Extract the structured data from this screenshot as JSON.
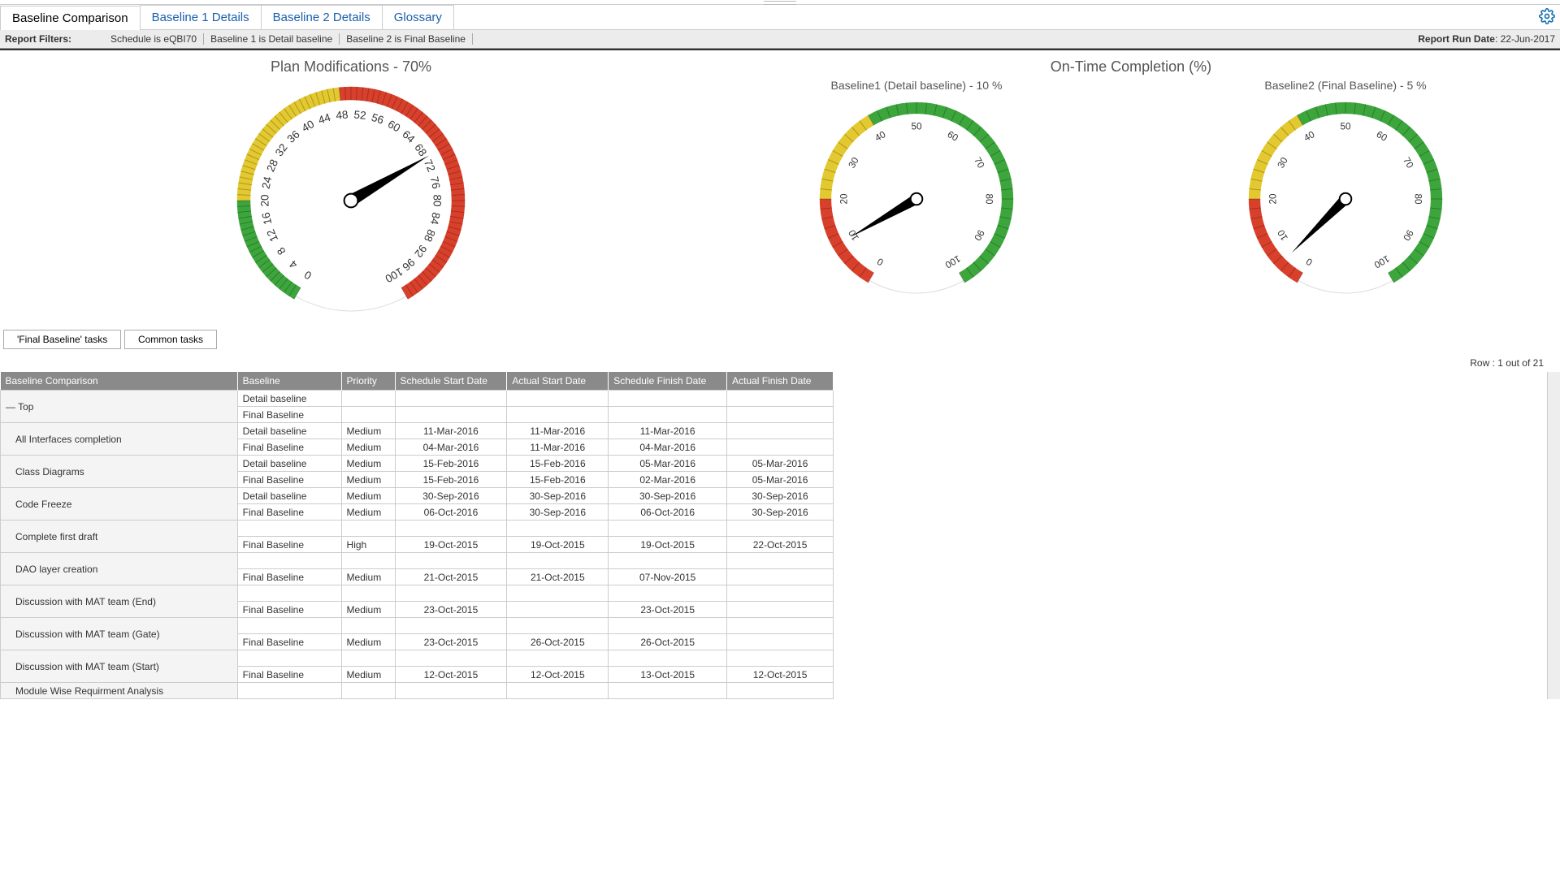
{
  "tabs": {
    "t0": "Baseline Comparison",
    "t1": "Baseline 1 Details",
    "t2": "Baseline 2 Details",
    "t3": "Glossary"
  },
  "filters": {
    "label": "Report Filters:",
    "f0": "Schedule   is   eQBI70",
    "f1": "Baseline 1   is   Detail baseline",
    "f2": "Baseline 2   is   Final Baseline",
    "run_label": "Report Run Date",
    "run_value": ": 22-Jun-2017"
  },
  "gauges": {
    "plan_title": "Plan Modifications - 70%",
    "ontime_title": "On-Time Completion (%)",
    "b1_sub": "Baseline1 (Detail baseline) - 10 %",
    "b2_sub": "Baseline2 (Final Baseline) - 5 %"
  },
  "buttons": {
    "final": "'Final Baseline' tasks",
    "common": "Common tasks"
  },
  "row_info": "Row : 1 out of 21",
  "columns": {
    "c0": "Baseline Comparison",
    "c1": "Baseline",
    "c2": "Priority",
    "c3": "Schedule Start Date",
    "c4": "Actual Start Date",
    "c5": "Schedule Finish Date",
    "c6": "Actual Finish Date"
  },
  "rows": {
    "top": "Top",
    "r0": {
      "name": "All Interfaces completion",
      "b0": "Detail baseline",
      "b1": "Final Baseline",
      "p": "Medium",
      "d00": "11-Mar-2016",
      "d01": "11-Mar-2016",
      "d02": "11-Mar-2016",
      "d03": "",
      "d10": "04-Mar-2016",
      "d11": "11-Mar-2016",
      "d12": "04-Mar-2016",
      "d13": ""
    },
    "r1": {
      "name": "Class Diagrams",
      "b0": "Detail baseline",
      "b1": "Final Baseline",
      "p": "Medium",
      "d00": "15-Feb-2016",
      "d01": "15-Feb-2016",
      "d02": "05-Mar-2016",
      "d03": "05-Mar-2016",
      "d10": "15-Feb-2016",
      "d11": "15-Feb-2016",
      "d12": "02-Mar-2016",
      "d13": "05-Mar-2016"
    },
    "r2": {
      "name": "Code Freeze",
      "b0": "Detail baseline",
      "b1": "Final Baseline",
      "p": "Medium",
      "d00": "30-Sep-2016",
      "d01": "30-Sep-2016",
      "d02": "30-Sep-2016",
      "d03": "30-Sep-2016",
      "d10": "06-Oct-2016",
      "d11": "30-Sep-2016",
      "d12": "06-Oct-2016",
      "d13": "30-Sep-2016"
    },
    "r3": {
      "name": "Complete first draft",
      "b0": "",
      "b1": "Final Baseline",
      "p0": "",
      "p1": "High",
      "d00": "",
      "d01": "",
      "d02": "",
      "d03": "",
      "d10": "19-Oct-2015",
      "d11": "19-Oct-2015",
      "d12": "19-Oct-2015",
      "d13": "22-Oct-2015"
    },
    "r4": {
      "name": "DAO layer creation",
      "b0": "",
      "b1": "Final Baseline",
      "p0": "",
      "p1": "Medium",
      "d00": "",
      "d01": "",
      "d02": "",
      "d03": "",
      "d10": "21-Oct-2015",
      "d11": "21-Oct-2015",
      "d12": "07-Nov-2015",
      "d13": ""
    },
    "r5": {
      "name": "Discussion with MAT team (End)",
      "b0": "",
      "b1": "Final Baseline",
      "p0": "",
      "p1": "Medium",
      "d00": "",
      "d01": "",
      "d02": "",
      "d03": "",
      "d10": "23-Oct-2015",
      "d11": "",
      "d12": "23-Oct-2015",
      "d13": ""
    },
    "r6": {
      "name": "Discussion with MAT team (Gate)",
      "b0": "",
      "b1": "Final Baseline",
      "p0": "",
      "p1": "Medium",
      "d00": "",
      "d01": "",
      "d02": "",
      "d03": "",
      "d10": "23-Oct-2015",
      "d11": "26-Oct-2015",
      "d12": "26-Oct-2015",
      "d13": ""
    },
    "r7": {
      "name": "Discussion with MAT team (Start)",
      "b0": "",
      "b1": "Final Baseline",
      "p0": "",
      "p1": "Medium",
      "d00": "",
      "d01": "",
      "d02": "",
      "d03": "",
      "d10": "12-Oct-2015",
      "d11": "12-Oct-2015",
      "d12": "13-Oct-2015",
      "d13": "12-Oct-2015"
    },
    "r8": {
      "name": "Module Wise Requirment Analysis"
    },
    "detail": "Detail baseline",
    "final": "Final Baseline"
  },
  "chart_data": [
    {
      "type": "gauge",
      "title": "Plan Modifications - 70%",
      "value": 70,
      "min": 0,
      "max": 100,
      "ticks": [
        0,
        4,
        8,
        12,
        16,
        20,
        24,
        28,
        32,
        36,
        40,
        44,
        48,
        52,
        56,
        60,
        64,
        68,
        72,
        76,
        80,
        84,
        88,
        92,
        96,
        100
      ],
      "bands": [
        {
          "from": 0,
          "to": 20,
          "color": "#3ca63c"
        },
        {
          "from": 20,
          "to": 48,
          "color": "#e3c92f"
        },
        {
          "from": 48,
          "to": 100,
          "color": "#d9402c"
        }
      ]
    },
    {
      "type": "gauge",
      "title": "Baseline1 (Detail baseline) - 10 %",
      "value": 10,
      "min": 0,
      "max": 100,
      "ticks": [
        0,
        10,
        20,
        30,
        40,
        50,
        60,
        70,
        80,
        90,
        100
      ],
      "bands": [
        {
          "from": 0,
          "to": 20,
          "color": "#d9402c"
        },
        {
          "from": 20,
          "to": 40,
          "color": "#e3c92f"
        },
        {
          "from": 40,
          "to": 100,
          "color": "#3ca63c"
        }
      ]
    },
    {
      "type": "gauge",
      "title": "Baseline2 (Final Baseline) - 5 %",
      "value": 5,
      "min": 0,
      "max": 100,
      "ticks": [
        0,
        10,
        20,
        30,
        40,
        50,
        60,
        70,
        80,
        90,
        100
      ],
      "bands": [
        {
          "from": 0,
          "to": 20,
          "color": "#d9402c"
        },
        {
          "from": 20,
          "to": 40,
          "color": "#e3c92f"
        },
        {
          "from": 40,
          "to": 100,
          "color": "#3ca63c"
        }
      ]
    }
  ]
}
